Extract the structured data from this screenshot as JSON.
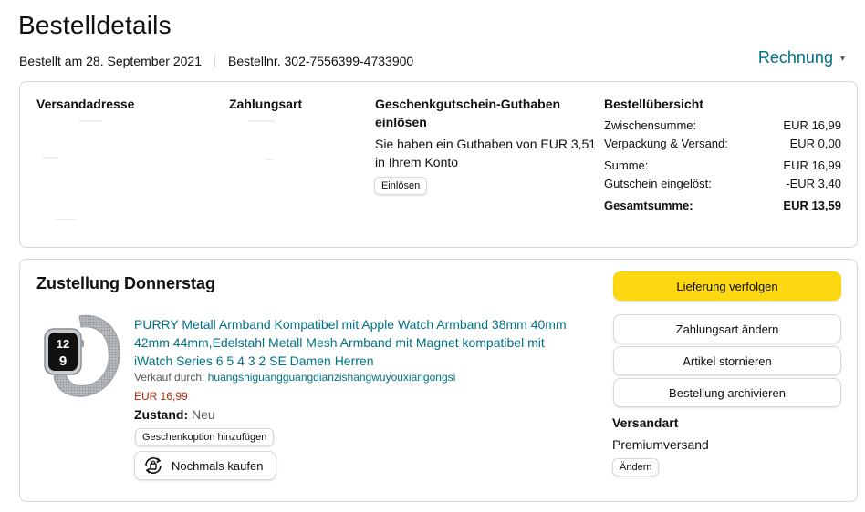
{
  "header": {
    "title": "Bestelldetails",
    "ordered_on": "Bestellt am 28. September 2021",
    "order_number": "Bestellnr. 302-7556399-4733900",
    "invoice_label": "Rechnung"
  },
  "summary": {
    "shipping_address_title": "Versandadresse",
    "payment_title": "Zahlungsart",
    "giftcard_title_line1": "Geschenkgutschein-Guthaben",
    "giftcard_title_line2": "einlösen",
    "giftcard_text_line1": "Sie haben ein Guthaben von EUR 3,51",
    "giftcard_text_line2": "in Ihrem Konto",
    "redeem_label": "Einlösen",
    "overview_title": "Bestellübersicht",
    "rows": [
      {
        "label": "Zwischensumme:",
        "value": "EUR 16,99"
      },
      {
        "label": "Verpackung & Versand:",
        "value": "EUR 0,00"
      },
      {
        "label": "Summe:",
        "value": "EUR 16,99"
      },
      {
        "label": "Gutschein eingelöst:",
        "value": "-EUR 3,40"
      },
      {
        "label": "Gesamtsumme:",
        "value": "EUR 13,59"
      }
    ]
  },
  "delivery": {
    "title": "Zustellung Donnerstag",
    "product_title_line1": "PURRY Metall Armband Kompatibel mit Apple Watch Armband 38mm 40mm",
    "product_title_line2": "42mm 44mm,Edelstahl Metall Mesh Armband mit Magnet kompatibel mit",
    "product_title_line3": "iWatch Series 6 5 4 3 2 SE Damen Herren",
    "sold_by_label": "Verkauf durch:",
    "seller": "huangshiguangguangdianzishangwuyouxiangongsi",
    "price": "EUR 16,99",
    "condition_label": "Zustand:",
    "condition_value": "Neu",
    "gift_option_label": "Geschenkoption hinzufügen",
    "buy_again_label": "Nochmals kaufen",
    "watch_time_top": "12",
    "watch_time_bottom": "9",
    "actions": {
      "track": "Lieferung verfolgen",
      "change_payment": "Zahlungsart ändern",
      "cancel": "Artikel stornieren",
      "archive": "Bestellung archivieren"
    },
    "shipping_type_title": "Versandart",
    "shipping_type_value": "Premiumversand",
    "change_label": "Ändern"
  },
  "colors": {
    "link": "#007185",
    "price": "#b12704",
    "primary_button": "#ffd814",
    "border": "#d5d9d9"
  }
}
